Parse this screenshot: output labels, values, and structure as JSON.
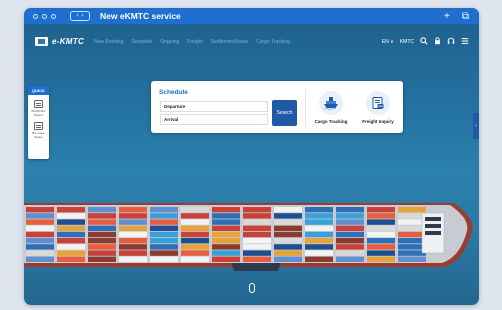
{
  "window": {
    "title": "New eKMTC service",
    "nav_back": "‹",
    "nav_forward": "›",
    "new_tab_label": "+",
    "restore_icon": "⧉"
  },
  "header": {
    "logo_text": "e-KMTC",
    "menu": [
      "New Booking",
      "Schedule",
      "Ongoing",
      "Freight",
      "Settlement/Issue",
      "Cargo Tracking"
    ],
    "language": "EN ∨",
    "brand_short": "KMTC"
  },
  "quick": {
    "title": "QUICK",
    "items": [
      {
        "label": "BOOKING Search",
        "icon": "document-icon"
      },
      {
        "label": "B/L Issue Status",
        "icon": "document-icon"
      }
    ]
  },
  "schedule": {
    "title": "Schedule",
    "departure": "Departure",
    "arrival": "Arrival",
    "search_label": "Search"
  },
  "tiles": [
    {
      "label": "Cargo Tracking",
      "icon": "ship-icon"
    },
    {
      "label": "Freight Inquiry",
      "icon": "invoice-icon"
    }
  ],
  "colors": {
    "accent": "#1f6fd1",
    "button": "#1f5aa8",
    "sea": "#2a7aa5"
  }
}
